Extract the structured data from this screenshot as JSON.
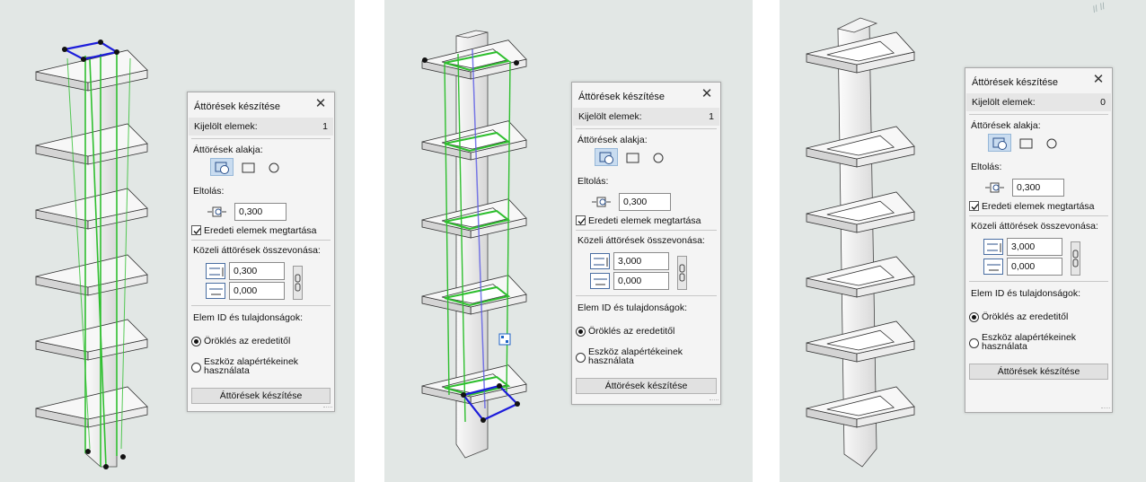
{
  "panels": [
    {
      "dialog": {
        "title": "Áttörések készítése",
        "close": "✕",
        "selected_label": "Kijelölt elemek:",
        "selected_count": "1",
        "shape_label": "Áttörések alakja:",
        "shape_options": [
          "contour-shape-icon",
          "rectangle-shape-icon",
          "circle-shape-icon"
        ],
        "shape_selected": "contour-shape-icon",
        "offset_label": "Eltolás:",
        "offset_value": "0,300",
        "keep_label": "Eredeti elemek megtartása",
        "keep_checked": true,
        "merge_label": "Közeli áttörések összevonása:",
        "merge_vertical": "0,300",
        "merge_horizontal": "0,000",
        "id_label": "Elem ID és tulajdonságok:",
        "radio_inherit": "Öröklés az eredetitől",
        "radio_tool_line1": "Eszköz alapértékeinek",
        "radio_tool_line2": "használata",
        "radio_selected": "inherit",
        "button": "Áttörések készítése"
      }
    },
    {
      "dialog": {
        "title": "Áttörések készítése",
        "close": "✕",
        "selected_label": "Kijelölt elemek:",
        "selected_count": "1",
        "shape_label": "Áttörések alakja:",
        "shape_options": [
          "contour-shape-icon",
          "rectangle-shape-icon",
          "circle-shape-icon"
        ],
        "shape_selected": "contour-shape-icon",
        "offset_label": "Eltolás:",
        "offset_value": "0,300",
        "keep_label": "Eredeti elemek megtartása",
        "keep_checked": true,
        "merge_label": "Közeli áttörések összevonása:",
        "merge_vertical": "3,000",
        "merge_horizontal": "0,000",
        "id_label": "Elem ID és tulajdonságok:",
        "radio_inherit": "Öröklés az eredetitől",
        "radio_tool_line1": "Eszköz alapértékeinek",
        "radio_tool_line2": "használata",
        "radio_selected": "inherit",
        "button": "Áttörések készítése"
      }
    },
    {
      "dialog": {
        "title": "Áttörések készítése",
        "close": "✕",
        "selected_label": "Kijelölt elemek:",
        "selected_count": "0",
        "shape_label": "Áttörések alakja:",
        "shape_options": [
          "contour-shape-icon",
          "rectangle-shape-icon",
          "circle-shape-icon"
        ],
        "shape_selected": "contour-shape-icon",
        "offset_label": "Eltolás:",
        "offset_value": "0,300",
        "keep_label": "Eredeti elemek megtartása",
        "keep_checked": true,
        "merge_label": "Közeli áttörések összevonása:",
        "merge_vertical": "3,000",
        "merge_horizontal": "0,000",
        "id_label": "Elem ID és tulajdonságok:",
        "radio_inherit": "Öröklés az eredetitől",
        "radio_tool_line1": "Eszköz alapértékeinek",
        "radio_tool_line2": "használata",
        "radio_selected": "inherit",
        "button": "Áttörések készítése"
      }
    }
  ],
  "colors": {
    "viewport_bg": "#e2e7e5",
    "selection_green": "#2fbf2f",
    "selection_blue": "#1d1ddb",
    "active_button": "#c9dcf0"
  }
}
